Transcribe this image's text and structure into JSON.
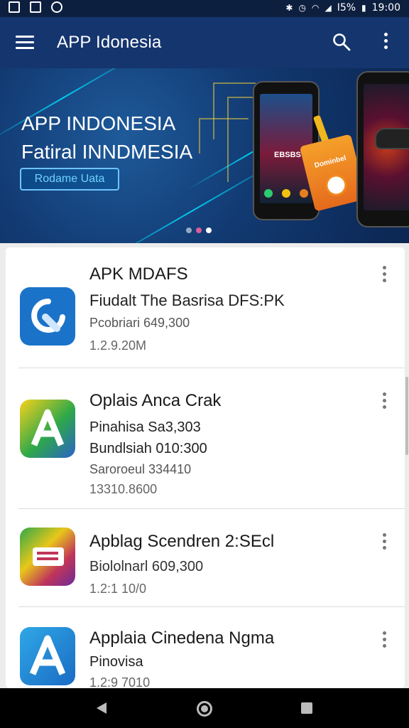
{
  "app": {
    "title": "APP Idonesia"
  },
  "status_bar": {
    "battery": "I5%",
    "time": "19:00"
  },
  "banner": {
    "heading": "APP INDONESIA",
    "subheading": "Fatiral INNDMESIA",
    "button_label": "Rodame Uata",
    "phone_screen_text": "EBSBS",
    "tag_text": "Dominbel",
    "page_count": 3,
    "active_page": 3
  },
  "apps": [
    {
      "title": "APK MDAFS",
      "lines": [
        "Fiudalt The Basrisa DFS:PK",
        "Pcobriari  649,300",
        "1.2.9.20M"
      ],
      "icon": "refresh-tool-icon"
    },
    {
      "title": "Oplais Anca Crak",
      "lines": [
        "Pinahisa Sa3,303",
        "Bundlsiah 010:300",
        "Saroroeul 334410",
        "13310.8600"
      ],
      "icon": "letter-a-icon"
    },
    {
      "title": "Apblag Scendren 2:SEcl",
      "lines": [
        "Biololnarl  609,300",
        "1.2:1  10/0"
      ],
      "icon": "screen-icon"
    },
    {
      "title": "Applaia Cinedena Ngma",
      "lines": [
        "Pinovisa",
        "1.2:9 7010"
      ],
      "icon": "letter-a-blue-icon"
    }
  ],
  "colors": {
    "appbar": "#15356e",
    "status_bar": "#0d1f3f",
    "banner_accent": "#6fd1ff"
  }
}
